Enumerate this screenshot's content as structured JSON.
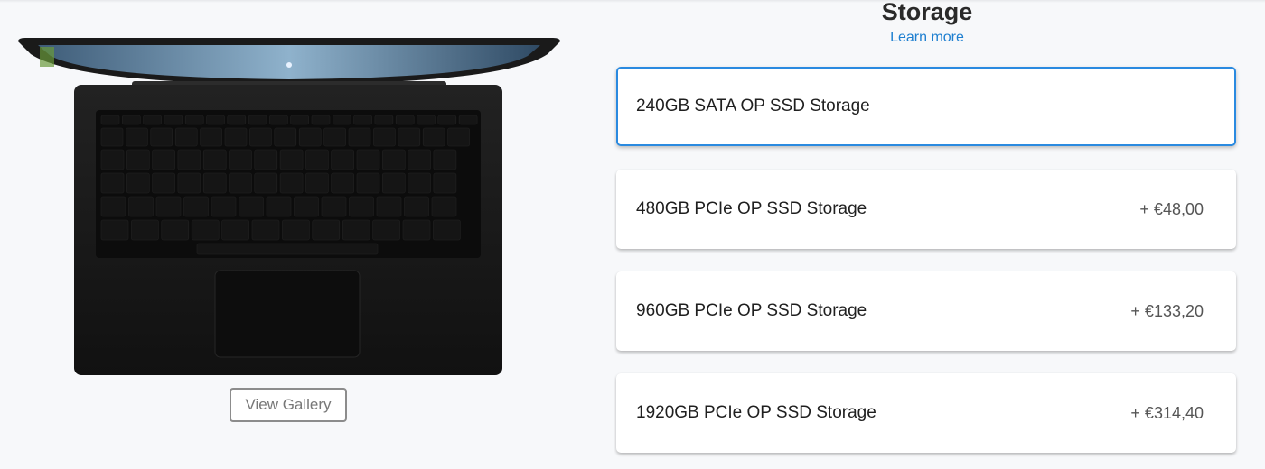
{
  "product": {
    "gallery_button": "View Gallery",
    "image": "laptop-top-view"
  },
  "storage": {
    "title": "Storage",
    "learn_more": "Learn more",
    "options": [
      {
        "label": "240GB SATA OP SSD Storage",
        "price": "",
        "selected": true
      },
      {
        "label": "480GB PCIe OP SSD Storage",
        "price": "+ €48,00",
        "selected": false
      },
      {
        "label": "960GB PCIe OP SSD Storage",
        "price": "+ €133,20",
        "selected": false
      },
      {
        "label": "1920GB PCIe OP SSD Storage",
        "price": "+ €314,40",
        "selected": false
      }
    ]
  },
  "colors": {
    "accent": "#2a8ae0",
    "link": "#1e7fd0",
    "background": "#f7f8fa"
  }
}
